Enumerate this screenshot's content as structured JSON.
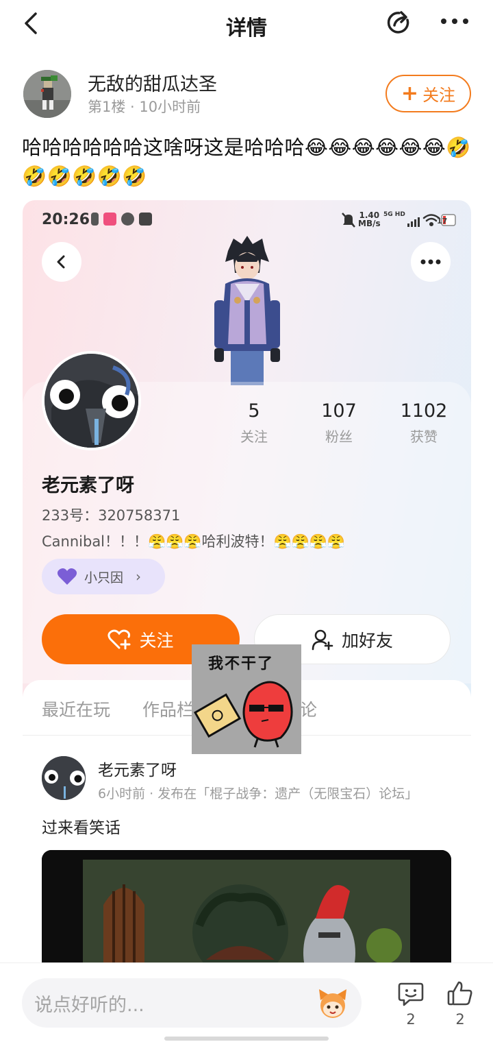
{
  "topbar": {
    "title": "详情"
  },
  "floor": {
    "username": "无敌的甜瓜达圣",
    "meta": "第1楼 · 10小时前",
    "follow_label": "关注",
    "comment": "哈哈哈哈哈哈这啥呀这是哈哈哈😂😂😂😂😂😂🤣🤣🤣🤣🤣🤣"
  },
  "screenshot": {
    "status_time": "20:26",
    "net_speed_value": "1.40",
    "net_speed_unit": "MB/s",
    "network": "5G HD",
    "battery": "17",
    "stats": [
      {
        "num": "5",
        "label": "关注"
      },
      {
        "num": "107",
        "label": "粉丝"
      },
      {
        "num": "1102",
        "label": "获赞"
      }
    ],
    "profile_name": "老元素了呀",
    "profile_id": "233号：320758371",
    "profile_bio": "Cannibal！！！😤😤😤哈利波特！😤😤😤😤",
    "chip_label": "小只因",
    "follow_btn": "关注",
    "friend_btn": "加好友",
    "tabs": [
      "最近在玩",
      "作品栏",
      "评论"
    ],
    "post": {
      "name": "老元素了呀",
      "meta": "6小时前 · 发布在「棍子战争：遗产（无限宝石）论坛」",
      "text": "过来看笑话"
    },
    "sticker_text": "我不干了"
  },
  "bottombar": {
    "placeholder": "说点好听的...",
    "comment_count": "2",
    "like_count": "2"
  },
  "colors": {
    "accent": "#fb6f0a",
    "follow_outline": "#f37b1d",
    "chip_bg": "#e8e3fb"
  }
}
